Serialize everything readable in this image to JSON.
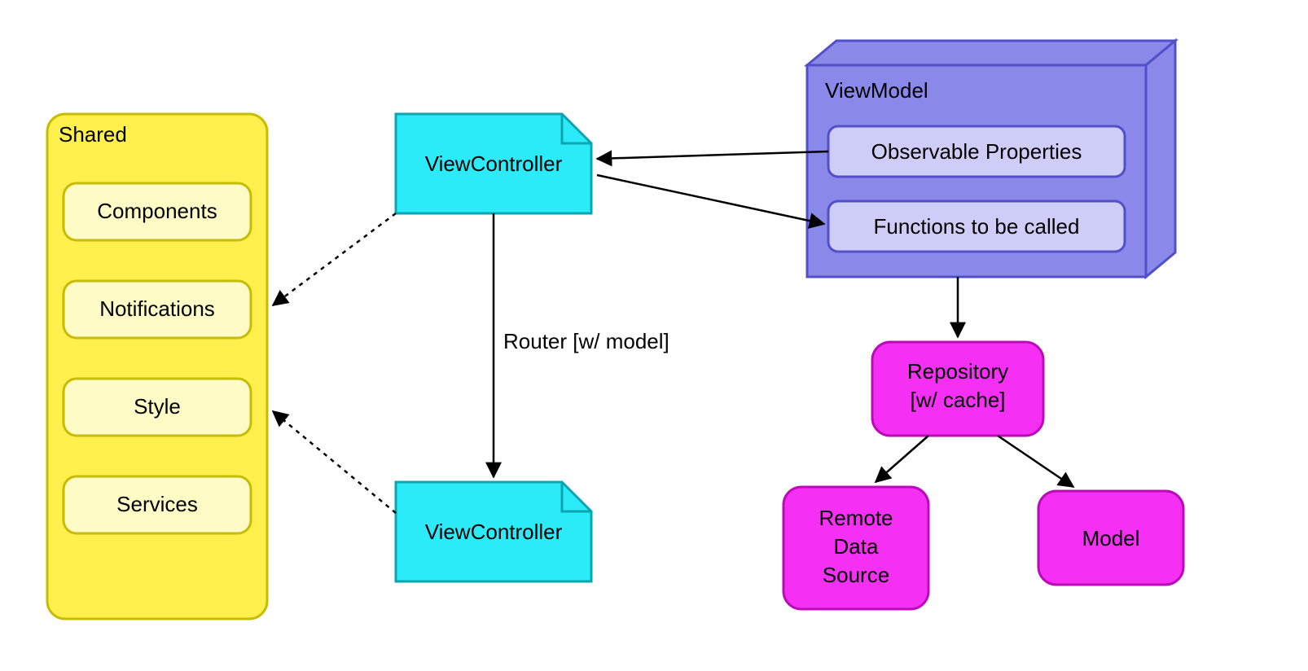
{
  "shared": {
    "title": "Shared",
    "items": [
      "Components",
      "Notifications",
      "Style",
      "Services"
    ]
  },
  "viewcontroller1": "ViewController",
  "viewcontroller2": "ViewController",
  "router_label": "Router [w/ model]",
  "viewmodel": {
    "title": "ViewModel",
    "observable": "Observable Properties",
    "functions": "Functions to be called"
  },
  "repository_line1": "Repository",
  "repository_line2": "[w/ cache]",
  "remote_line1": "Remote",
  "remote_line2": "Data",
  "remote_line3": "Source",
  "model": "Model",
  "colors": {
    "shared_bg": "#FFF04D",
    "shared_item_bg": "#FFFBC7",
    "shared_stroke": "#C7BC00",
    "vc_bg": "#2CEBF8",
    "vc_stroke": "#0AA5B0",
    "vm_bg": "#8A89EA",
    "vm_stroke": "#5150C9",
    "vm_item_bg": "#CECDF7",
    "vm_item_stroke": "#5150C9",
    "repo_bg": "#F52FF3",
    "repo_stroke": "#BB0BB9"
  }
}
